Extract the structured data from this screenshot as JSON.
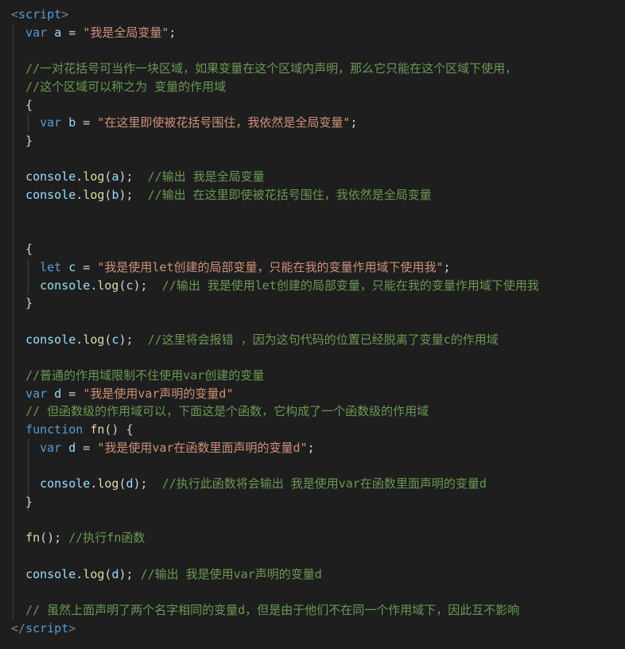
{
  "editor": {
    "language": "html-javascript",
    "theme": {
      "background": "#1e1e1e",
      "keyword": "#569cd6",
      "variable": "#9cdcfe",
      "string": "#ce9178",
      "comment": "#6a9955",
      "function": "#dcdcaa",
      "tag_bracket": "#808080",
      "plain": "#d4d4d4"
    },
    "lines": [
      [
        {
          "t": "<",
          "c": "tag"
        },
        {
          "t": "script",
          "c": "tagname"
        },
        {
          "t": ">",
          "c": "tag"
        }
      ],
      [
        {
          "t": "  "
        },
        {
          "t": "var",
          "c": "kw"
        },
        {
          "t": " "
        },
        {
          "t": "a",
          "c": "var"
        },
        {
          "t": " = "
        },
        {
          "t": "\"我是全局变量\"",
          "c": "str"
        },
        {
          "t": ";"
        }
      ],
      [],
      [
        {
          "t": "  "
        },
        {
          "t": "//一对花括号可当作一块区域，如果变量在这个区域内声明，那么它只能在这个区域下使用，",
          "c": "com"
        }
      ],
      [
        {
          "t": "  "
        },
        {
          "t": "//这个区域可以称之为 变量的作用域",
          "c": "com"
        }
      ],
      [
        {
          "t": "  {"
        }
      ],
      [
        {
          "t": "    "
        },
        {
          "t": "var",
          "c": "kw"
        },
        {
          "t": " "
        },
        {
          "t": "b",
          "c": "var"
        },
        {
          "t": " = "
        },
        {
          "t": "\"在这里即使被花括号围住，我依然是全局变量\"",
          "c": "str"
        },
        {
          "t": ";"
        }
      ],
      [
        {
          "t": "  }"
        }
      ],
      [],
      [
        {
          "t": "  "
        },
        {
          "t": "console",
          "c": "var"
        },
        {
          "t": "."
        },
        {
          "t": "log",
          "c": "fn"
        },
        {
          "t": "("
        },
        {
          "t": "a",
          "c": "var"
        },
        {
          "t": ");  "
        },
        {
          "t": "//输出 我是全局变量",
          "c": "com"
        }
      ],
      [
        {
          "t": "  "
        },
        {
          "t": "console",
          "c": "var"
        },
        {
          "t": "."
        },
        {
          "t": "log",
          "c": "fn"
        },
        {
          "t": "("
        },
        {
          "t": "b",
          "c": "var"
        },
        {
          "t": ");  "
        },
        {
          "t": "//输出 在这里即使被花括号围住，我依然是全局变量",
          "c": "com"
        }
      ],
      [],
      [],
      [
        {
          "t": "  {"
        }
      ],
      [
        {
          "t": "    "
        },
        {
          "t": "let",
          "c": "kw"
        },
        {
          "t": " "
        },
        {
          "t": "c",
          "c": "var"
        },
        {
          "t": " = "
        },
        {
          "t": "\"我是使用let创建的局部变量，只能在我的变量作用域下使用我\"",
          "c": "str"
        },
        {
          "t": ";"
        }
      ],
      [
        {
          "t": "    "
        },
        {
          "t": "console",
          "c": "var"
        },
        {
          "t": "."
        },
        {
          "t": "log",
          "c": "fn"
        },
        {
          "t": "("
        },
        {
          "t": "c",
          "c": "var"
        },
        {
          "t": ");  "
        },
        {
          "t": "//输出 我是使用let创建的局部变量，只能在我的变量作用域下使用我",
          "c": "com"
        }
      ],
      [
        {
          "t": "  }"
        }
      ],
      [],
      [
        {
          "t": "  "
        },
        {
          "t": "console",
          "c": "var"
        },
        {
          "t": "."
        },
        {
          "t": "log",
          "c": "fn"
        },
        {
          "t": "("
        },
        {
          "t": "c",
          "c": "var"
        },
        {
          "t": ");  "
        },
        {
          "t": "//这里将会报错 ，因为这句代码的位置已经脱离了变量c的作用域",
          "c": "com"
        }
      ],
      [],
      [
        {
          "t": "  "
        },
        {
          "t": "//普通的作用域限制不住使用var创建的变量",
          "c": "com"
        }
      ],
      [
        {
          "t": "  "
        },
        {
          "t": "var",
          "c": "kw"
        },
        {
          "t": " "
        },
        {
          "t": "d",
          "c": "var"
        },
        {
          "t": " = "
        },
        {
          "t": "\"我是使用var声明的变量d\"",
          "c": "str"
        }
      ],
      [
        {
          "t": "  "
        },
        {
          "t": "// 但函数级的作用域可以，下面这是个函数，它构成了一个函数级的作用域",
          "c": "com"
        }
      ],
      [
        {
          "t": "  "
        },
        {
          "t": "function",
          "c": "kw"
        },
        {
          "t": " "
        },
        {
          "t": "fn",
          "c": "fn"
        },
        {
          "t": "() {"
        }
      ],
      [
        {
          "t": "    "
        },
        {
          "t": "var",
          "c": "kw"
        },
        {
          "t": " "
        },
        {
          "t": "d",
          "c": "var"
        },
        {
          "t": " = "
        },
        {
          "t": "\"我是使用var在函数里面声明的变量d\"",
          "c": "str"
        },
        {
          "t": ";"
        }
      ],
      [],
      [
        {
          "t": "    "
        },
        {
          "t": "console",
          "c": "var"
        },
        {
          "t": "."
        },
        {
          "t": "log",
          "c": "fn"
        },
        {
          "t": "("
        },
        {
          "t": "d",
          "c": "var"
        },
        {
          "t": ");  "
        },
        {
          "t": "//执行此函数将会输出 我是使用var在函数里面声明的变量d",
          "c": "com"
        }
      ],
      [
        {
          "t": "  }"
        }
      ],
      [],
      [
        {
          "t": "  "
        },
        {
          "t": "fn",
          "c": "fn"
        },
        {
          "t": "(); "
        },
        {
          "t": "//执行fn函数",
          "c": "com"
        }
      ],
      [],
      [
        {
          "t": "  "
        },
        {
          "t": "console",
          "c": "var"
        },
        {
          "t": "."
        },
        {
          "t": "log",
          "c": "fn"
        },
        {
          "t": "("
        },
        {
          "t": "d",
          "c": "var"
        },
        {
          "t": "); "
        },
        {
          "t": "//输出 我是使用var声明的变量d",
          "c": "com"
        }
      ],
      [],
      [
        {
          "t": "  "
        },
        {
          "t": "// 虽然上面声明了两个名字相同的变量d，但是由于他们不在同一个作用域下，因此互不影响",
          "c": "com"
        }
      ],
      [
        {
          "t": "</",
          "c": "tag"
        },
        {
          "t": "script",
          "c": "tagname"
        },
        {
          "t": ">",
          "c": "tag"
        }
      ]
    ]
  }
}
